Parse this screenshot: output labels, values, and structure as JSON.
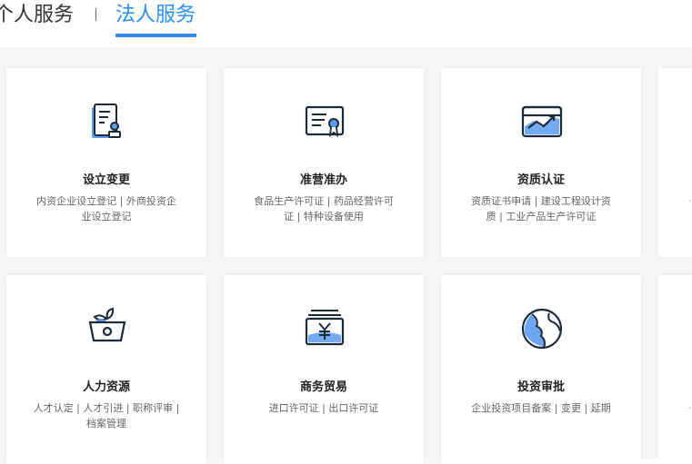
{
  "tabs": {
    "personal": "个人服务",
    "legal": "法人服务"
  },
  "colors": {
    "accent": "#2b8ef0",
    "icon_stroke": "#1d2a3a",
    "icon_fill": "#5b9bf2"
  },
  "cards": [
    {
      "icon": "certificate-change-icon",
      "title": "设立变更",
      "desc": "内资企业设立登记 | 外商投资企业设立登记"
    },
    {
      "icon": "license-ribbon-icon",
      "title": "准营准办",
      "desc": "食品生产许可证 | 药品经营许可证 | 特种设备使用"
    },
    {
      "icon": "qualification-chart-icon",
      "title": "资质认证",
      "desc": "资质证书申请 | 建设工程设计资质 | 工业产品生产许可证"
    },
    {
      "icon": "fruit-basket-icon",
      "title": "人力资源",
      "desc": "人才认定 | 人才引进 | 职称评审 | 档案管理"
    },
    {
      "icon": "yuan-trade-icon",
      "title": "商务贸易",
      "desc": "进口许可证 | 出口许可证"
    },
    {
      "icon": "globe-investment-icon",
      "title": "投资审批",
      "desc": "企业投资项目备案 | 变更 | 延期"
    }
  ]
}
